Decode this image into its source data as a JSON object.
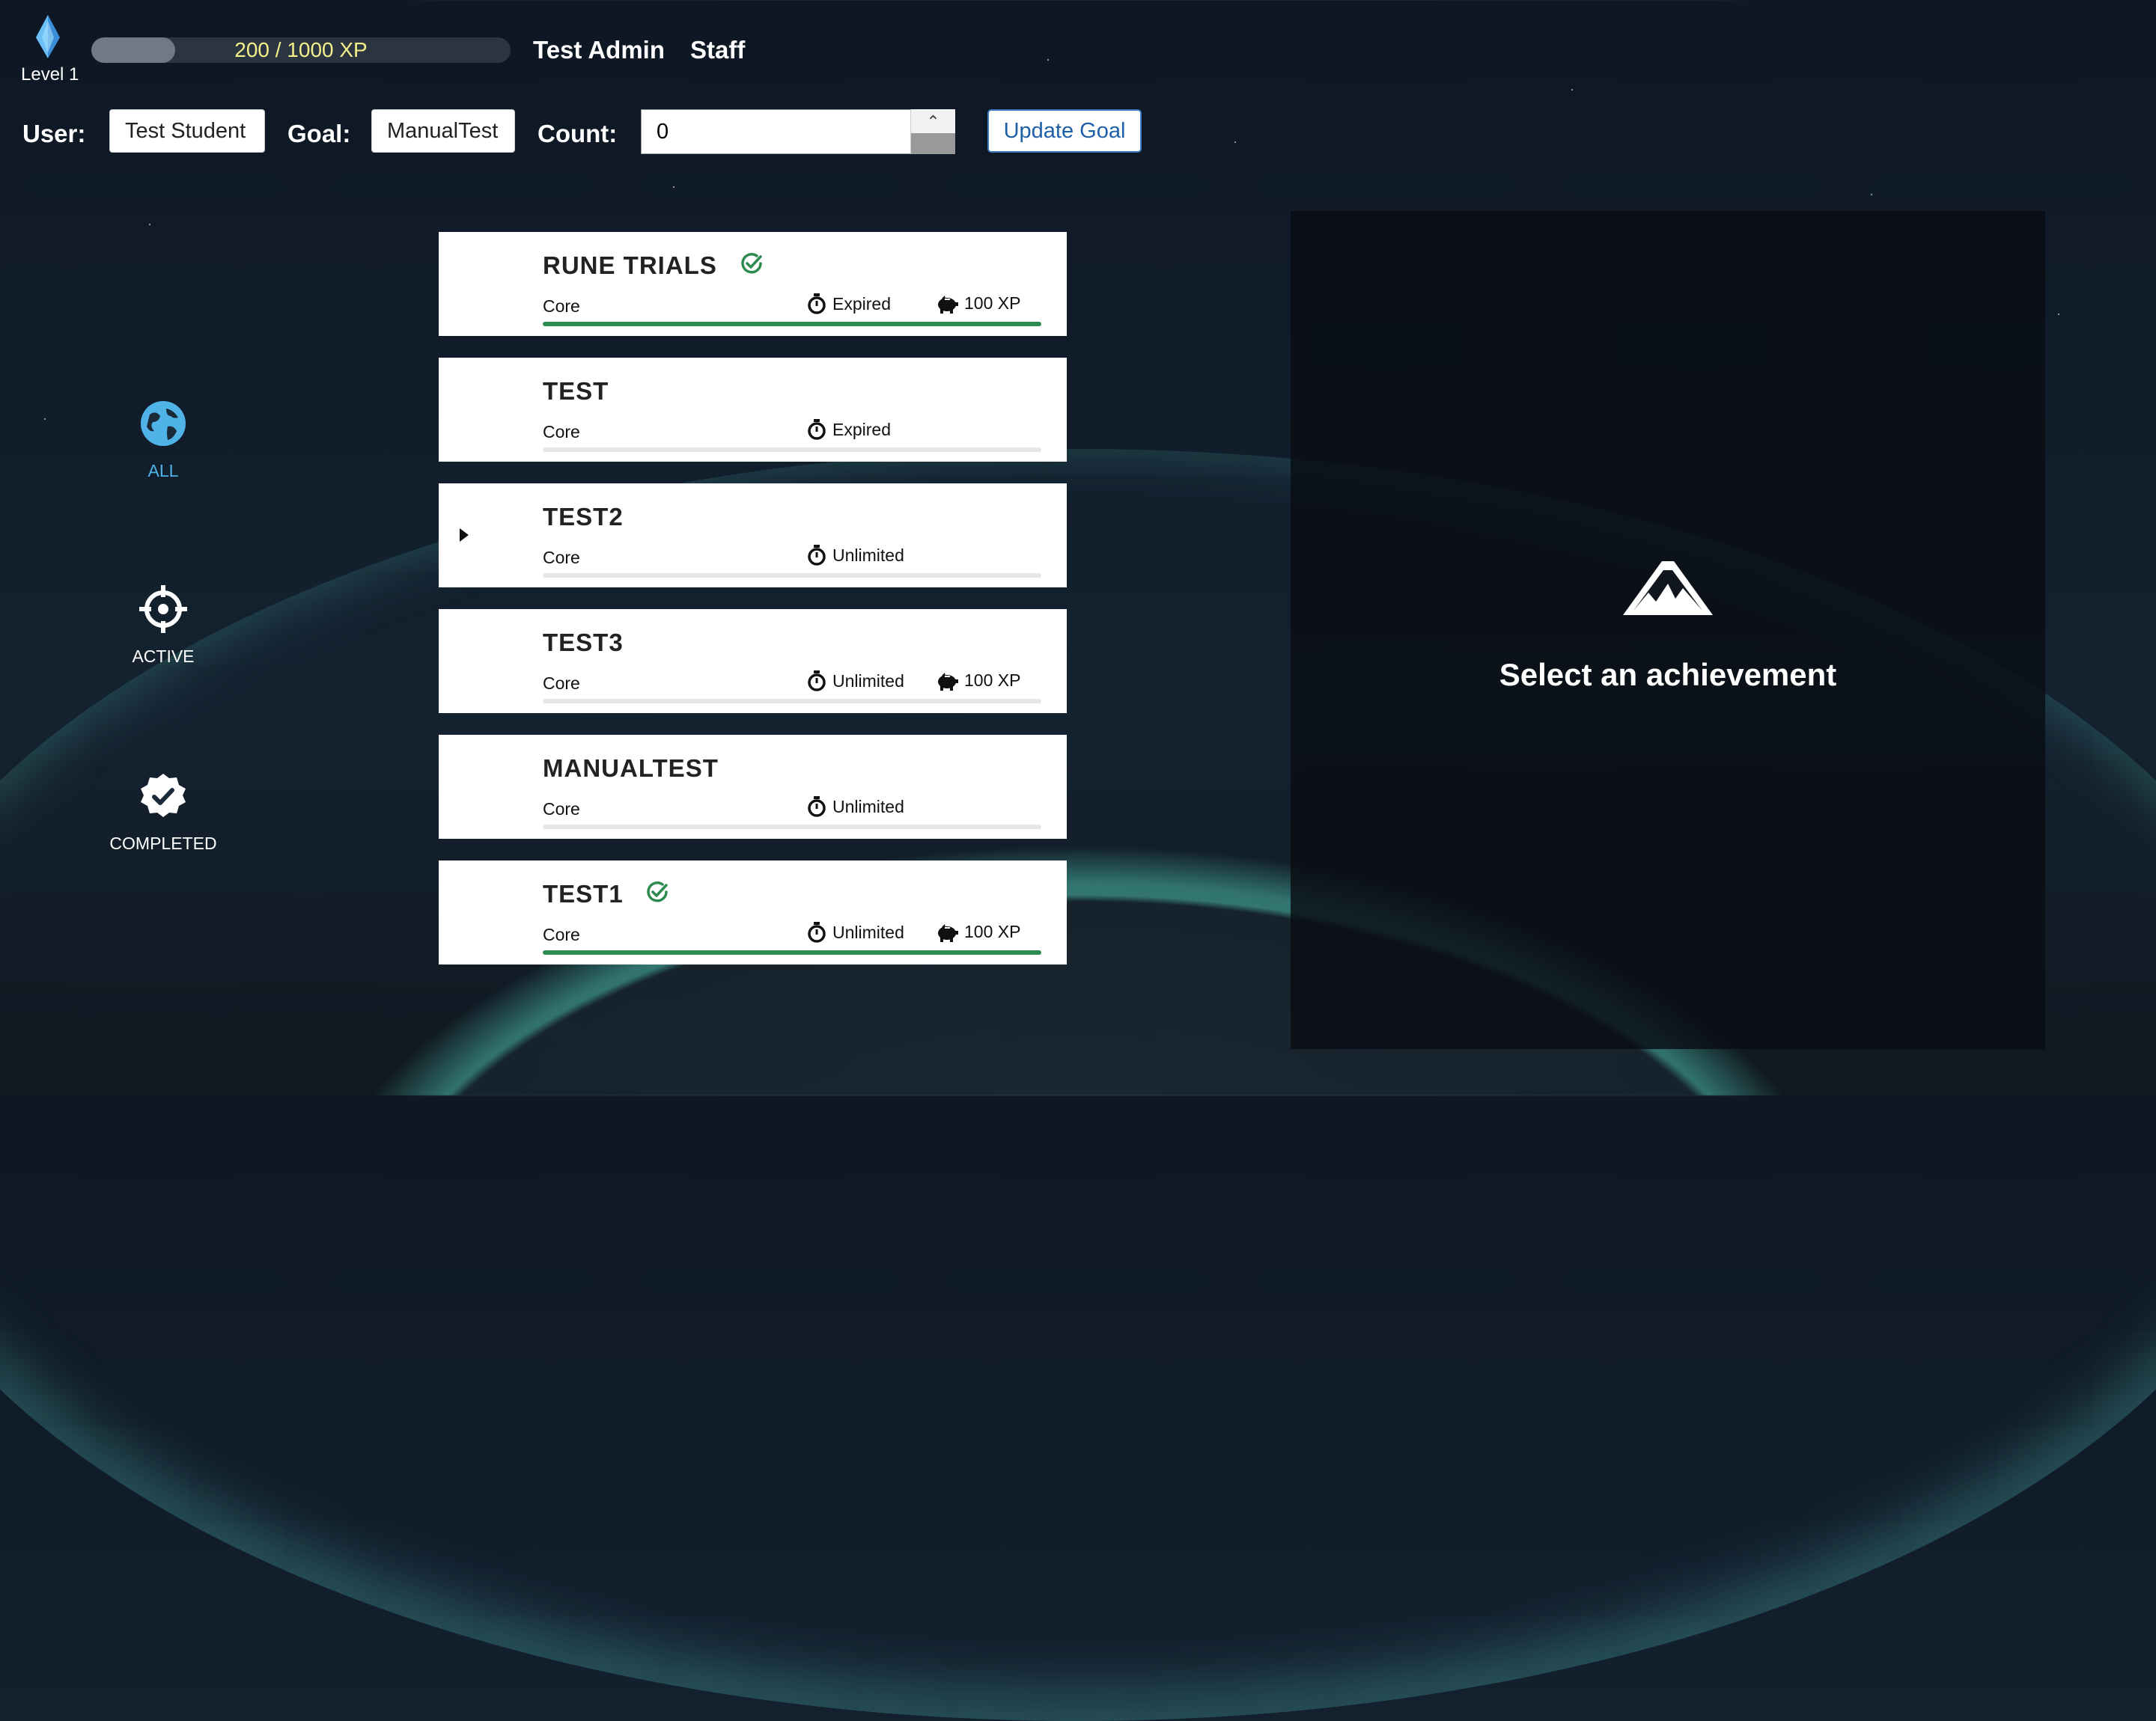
{
  "header": {
    "level_label": "Level 1",
    "xp_text": "200 / 1000 XP",
    "xp_fraction": 0.2,
    "user_name": "Test Admin",
    "user_role": "Staff"
  },
  "controls": {
    "user_label": "User:",
    "user_value": "Test Student",
    "goal_label": "Goal:",
    "goal_value": "ManualTest",
    "count_label": "Count:",
    "count_value": "0",
    "update_button": "Update Goal"
  },
  "sidebar": {
    "items": [
      {
        "label": "ALL",
        "icon": "globe-icon",
        "active": true
      },
      {
        "label": "ACTIVE",
        "icon": "crosshair-icon",
        "active": false
      },
      {
        "label": "COMPLETED",
        "icon": "check-badge-icon",
        "active": false
      }
    ]
  },
  "achievements": [
    {
      "title": "RUNE TRIALS",
      "category": "Core",
      "timer": "Expired",
      "xp": "100 XP",
      "completed": true,
      "progress": 1.0,
      "expandable": false
    },
    {
      "title": "TEST",
      "category": "Core",
      "timer": "Expired",
      "xp": "",
      "completed": false,
      "progress": 0,
      "expandable": false
    },
    {
      "title": "TEST2",
      "category": "Core",
      "timer": "Unlimited",
      "xp": "",
      "completed": false,
      "progress": 0,
      "expandable": true
    },
    {
      "title": "TEST3",
      "category": "Core",
      "timer": "Unlimited",
      "xp": "100 XP",
      "completed": false,
      "progress": 0,
      "expandable": false
    },
    {
      "title": "MANUALTEST",
      "category": "Core",
      "timer": "Unlimited",
      "xp": "",
      "completed": false,
      "progress": 0,
      "expandable": false
    },
    {
      "title": "TEST1",
      "category": "Core",
      "timer": "Unlimited",
      "xp": "100 XP",
      "completed": true,
      "progress": 1.0,
      "expandable": false
    }
  ],
  "detail_panel": {
    "placeholder": "Select an achievement",
    "icon": "mountain-icon"
  },
  "colors": {
    "accent_blue": "#4fb3e8",
    "complete_green": "#2e8b4f",
    "xp_text": "#f4f08a"
  }
}
